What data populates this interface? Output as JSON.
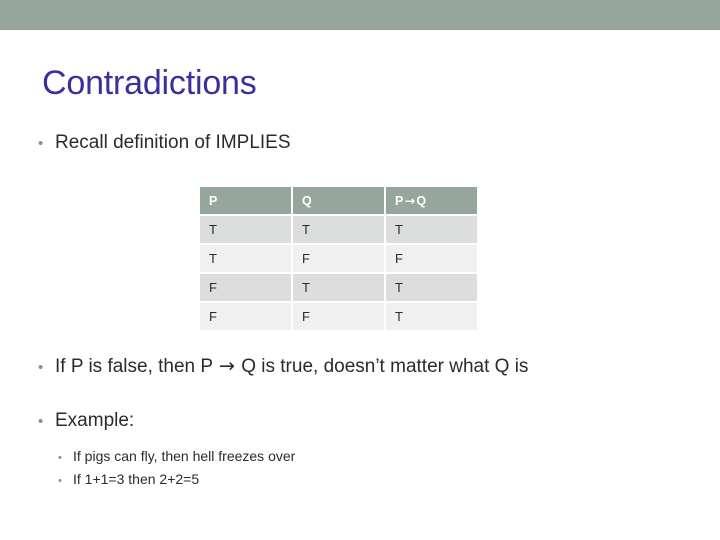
{
  "slide": {
    "title": "Contradictions",
    "accent_color": "#96a69c",
    "title_color": "#3a2f9b",
    "background_color": "#ffffff"
  },
  "bullets": {
    "recall": {
      "marker": "•",
      "text": "Recall definition of IMPLIES"
    },
    "if_false": {
      "marker": "•",
      "text_before_arrow": "If P is false, then P ",
      "arrow": "→",
      "text_after_arrow": " Q is true, doesn’t matter what Q is"
    },
    "example": {
      "marker": "•",
      "text": "Example:"
    },
    "sub_items": [
      {
        "marker": "•",
        "text": "If pigs can fly, then hell freezes over"
      },
      {
        "marker": "•",
        "text": "If 1+1=3 then 2+2=5"
      }
    ]
  },
  "truth_table": {
    "headers": {
      "p": "P",
      "q": "Q",
      "implies_before": "P",
      "implies_arrow": "→",
      "implies_after": "Q"
    },
    "rows": [
      {
        "p": "T",
        "q": "T",
        "pq": "T"
      },
      {
        "p": "T",
        "q": "F",
        "pq": "F"
      },
      {
        "p": "F",
        "q": "T",
        "pq": "T"
      },
      {
        "p": "F",
        "q": "F",
        "pq": "T"
      }
    ],
    "header_bg": "#96a69c",
    "row_dark_bg": "#dcdedd",
    "row_light_bg": "#eff0ef"
  }
}
